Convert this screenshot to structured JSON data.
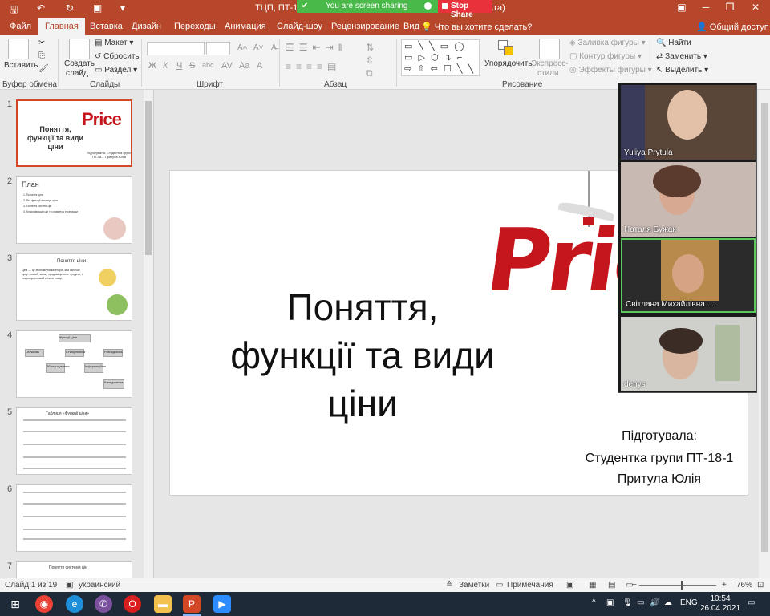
{
  "titlebar": {
    "title": "ТЦП, ПТ-18",
    "title_suffix": "ктa)",
    "screen_sharing": "You are screen sharing",
    "stop_share": "Stop Share",
    "brand_color": "#b7472a"
  },
  "tabs": {
    "file": "Файл",
    "home": "Главная",
    "insert": "Вставка",
    "design": "Дизайн",
    "transitions": "Переходы",
    "animation": "Анимация",
    "slideshow": "Слайд-шоу",
    "review": "Рецензирование",
    "view": "Вид",
    "tell_me": "Что вы хотите сделать?",
    "share": "Общий доступ"
  },
  "ribbon": {
    "clipboard": {
      "paste": "Вставить",
      "label": "Буфер обмена"
    },
    "slides": {
      "new_slide_1": "Создать",
      "new_slide_2": "слайд",
      "layout": "Макет",
      "reset": "Сбросить",
      "section": "Раздел",
      "label": "Слайды"
    },
    "font": {
      "label": "Шрифт",
      "bold": "Ж",
      "italic": "К",
      "underline": "Ч",
      "strike": "S",
      "shadow": "abc"
    },
    "paragraph": {
      "label": "Абзац"
    },
    "drawing": {
      "arrange": "Упорядочить",
      "quick_styles_1": "Экспресс-",
      "quick_styles_2": "стили",
      "shape_fill": "Заливка фигуры",
      "shape_outline": "Контур фигуры",
      "shape_effects": "Эффекты фигуры",
      "label": "Рисование",
      "shapes": "▭ ╲ ╲ ▭ ◯ ▭ ▷ ⬡ ↴ ⌐ ⇨ ⇧ ⇦ ☐ ╲ ╲ ⌒ { } ☆"
    },
    "editing": {
      "find": "Найти",
      "replace": "Заменить",
      "select": "Выделить"
    }
  },
  "thumbnails": [
    {
      "num": "1",
      "title": "Поняття, функції та види ціни",
      "logo": "Price",
      "author": "Підготувала: Студентка групи ПТ-18-1 Притула Юлія"
    },
    {
      "num": "2",
      "title": "План",
      "items": [
        "1. Поняття ціни",
        "2. Які функції виконує ціна",
        "3. Поняття систем цін",
        "4. Класифікація цін та розвиток економіки"
      ]
    },
    {
      "num": "3",
      "title": "Поняття ціни",
      "body": "Ціна — це економічна категорія, яка означає суму грошей, за яку продавець хоче продати, а покупець готовий купити товар."
    },
    {
      "num": "4",
      "title": "Функції ціни",
      "nodes": [
        "Облікова",
        "Стимулююча",
        "Розподільча",
        "Збалансування",
        "Інформаційна",
        "Конкурентна"
      ]
    },
    {
      "num": "5",
      "title": "Таблиця «Функції ціни»"
    },
    {
      "num": "6",
      "title": ""
    },
    {
      "num": "7",
      "title": "Поняття системи цін"
    }
  ],
  "slide": {
    "title_line1": "Поняття,",
    "title_line2": "функції та види",
    "title_line3": "ціни",
    "logo": "Price",
    "author_line1": "Підготувала:",
    "author_line2": "Студентка групи ПТ-18-1",
    "author_line3": "Притула Юлія"
  },
  "participants": [
    {
      "name": "Yuliya Prytula"
    },
    {
      "name": "Наталя Бужак"
    },
    {
      "name": "Світлана Михайлівна ..."
    },
    {
      "name": "denys"
    }
  ],
  "status": {
    "slide_count": "Слайд 1 из 19",
    "language": "украинский",
    "notes": "Заметки",
    "comments": "Примечания",
    "zoom": "76%"
  },
  "taskbar": {
    "language": "ENG",
    "time": "10:54",
    "date": "26.04.2021"
  }
}
